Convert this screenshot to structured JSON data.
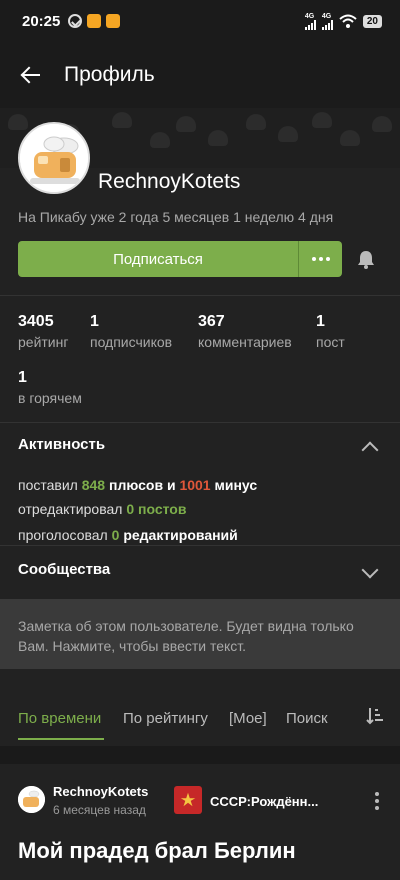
{
  "status_bar": {
    "time": "20:25",
    "net1": "4G",
    "net2": "4G",
    "battery": "20"
  },
  "header": {
    "title": "Профиль"
  },
  "profile": {
    "username": "RechnoyKotets",
    "since": "На Пикабу уже 2 года 5 месяцев 1 неделю 4 дня",
    "subscribe_label": "Подписаться"
  },
  "stats": [
    {
      "value": "3405",
      "label": "рейтинг"
    },
    {
      "value": "1",
      "label": "подписчиков"
    },
    {
      "value": "367",
      "label": "комментариев"
    },
    {
      "value": "1",
      "label": "пост"
    },
    {
      "value": "1",
      "label": "в горячем"
    }
  ],
  "activity": {
    "title": "Активность",
    "line1": {
      "prefix": "поставил",
      "pluses": "848",
      "mid": "плюсов и",
      "minuses": "1001",
      "suffix": "минус"
    },
    "line2": {
      "prefix": "отредактировал",
      "count": "0 постов"
    },
    "line3": {
      "prefix": "проголосовал",
      "count": "0",
      "suffix": "редактирований"
    }
  },
  "communities": {
    "title": "Сообщества"
  },
  "note": {
    "text": "Заметка об этом пользователе. Будет видна только Вам. Нажмите, чтобы ввести текст."
  },
  "tabs": [
    {
      "label": "По времени"
    },
    {
      "label": "По рейтингу"
    },
    {
      "label": "[Мое]"
    },
    {
      "label": "Поиск"
    }
  ],
  "post": {
    "author": "RechnoyKotets",
    "time": "6 месяцев назад",
    "community": "СССР:Рождённ...",
    "title": "Мой прадед брал Берлин"
  },
  "colors": {
    "accent": "#7dae4b",
    "minus": "#e0573a",
    "background": "#222222"
  },
  "icons": [
    "back-arrow-icon",
    "telegram-icon",
    "bell-icon",
    "more-dots-icon",
    "chevron-up-icon",
    "chevron-down-icon",
    "sort-icon",
    "kebab-menu-icon",
    "wifi-icon"
  ]
}
